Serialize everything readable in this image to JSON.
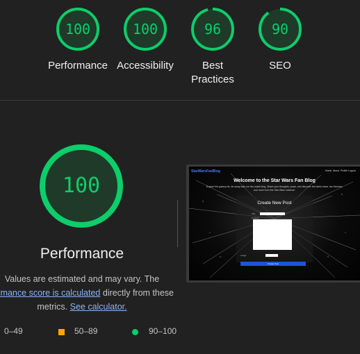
{
  "gauges": [
    {
      "score": "100",
      "label": "Performance",
      "fraction": 1.0
    },
    {
      "score": "100",
      "label": "Accessibility",
      "fraction": 1.0
    },
    {
      "score": "96",
      "label": "Best Practices",
      "fraction": 0.96
    },
    {
      "score": "90",
      "label": "SEO",
      "fraction": 0.9
    }
  ],
  "main": {
    "score": "100",
    "title": "Performance",
    "fraction": 1.0,
    "description_1": "Values are estimated and may vary. The",
    "link_1": "formance score is calculated",
    "description_2": "directly from these",
    "description_3": "metrics.",
    "link_2": "See calculator."
  },
  "legend": {
    "fail": "0–49",
    "average": "50–89",
    "pass": "90–100"
  },
  "screenshot": {
    "logo": "StarWarsFanBlog",
    "nav": [
      "Home",
      "About",
      "Profile",
      "Logout"
    ],
    "welcome": "Welcome to the Star Wars Fan Blog",
    "subtitle": "Explore the galaxy far, far away with our fan-made blog. Share your thoughts, posts, and discover the latest news, fan theories, and more from the Star Wars universe.",
    "form_title": "Create New Post",
    "title_label": "Title",
    "content_label": "Content",
    "image_label": "Image",
    "button": "Create Post"
  },
  "colors": {
    "background": "#212121",
    "pass_green": "#0cce6b",
    "average_orange": "#ffa400",
    "link_blue": "#8ab4f8"
  }
}
